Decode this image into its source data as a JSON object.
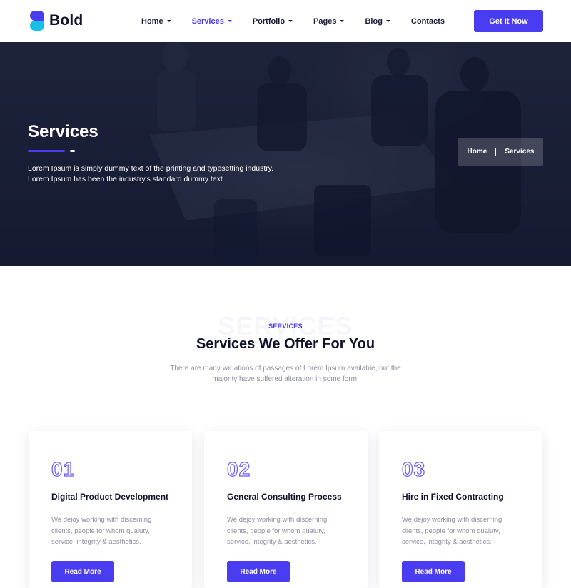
{
  "brand": {
    "name": "Bold",
    "primary": "#4a3cf0",
    "accent": "#19c0e6"
  },
  "nav": {
    "items": [
      {
        "label": "Home",
        "dropdown": true,
        "active": false
      },
      {
        "label": "Services",
        "dropdown": true,
        "active": true
      },
      {
        "label": "Portfolio",
        "dropdown": true,
        "active": false
      },
      {
        "label": "Pages",
        "dropdown": true,
        "active": false
      },
      {
        "label": "Blog",
        "dropdown": true,
        "active": false
      },
      {
        "label": "Contacts",
        "dropdown": false,
        "active": false
      }
    ],
    "cta_label": "Get It Now"
  },
  "hero": {
    "title": "Services",
    "text_line1": "Lorem Ipsum is simply dummy text of the printing and typesetting industry.",
    "text_line2": "Lorem Ipsum has been the industry's standard dummy text",
    "breadcrumb": {
      "home": "Home",
      "current": "Services"
    }
  },
  "services_section": {
    "ghost_text": "SERVICES",
    "kicker": "SERVICES",
    "title": "Services We Offer For You",
    "subtitle_line1": "There are many variations of passages of Lorem Ipsum available, but the",
    "subtitle_line2": "majority have suffered alteration in some form.",
    "cards": [
      {
        "number": "01",
        "title": "Digital Product Development",
        "text_line1": "We dejoy working with discerning",
        "text_line2": "clients, people for whom qualuty,",
        "text_line3": "service, integrity & aesthetics.",
        "button": "Read More"
      },
      {
        "number": "02",
        "title": "General Consulting Process",
        "text_line1": "We dejoy working with discerning",
        "text_line2": "clients, people for whom qualuty,",
        "text_line3": "service, integrity & aesthetics.",
        "button": "Read More"
      },
      {
        "number": "03",
        "title": "Hire in Fixed Contracting",
        "text_line1": "We dejoy working with discerning",
        "text_line2": "clients, people for whom qualuty,",
        "text_line3": "service, integrity & aesthetics.",
        "button": "Read More"
      }
    ]
  }
}
